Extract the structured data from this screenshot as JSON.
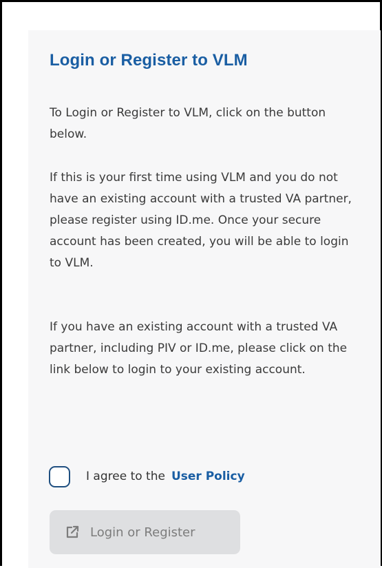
{
  "panel": {
    "title": "Login or Register to VLM",
    "paragraphs": [
      "To Login or Register to VLM, click on the button below.",
      "If this is your first time using VLM and you do not have an existing account with a trusted VA partner, please register using ID.me. Once your secure account has been created, you will be able to login to VLM.",
      "If you have an existing account with a trusted VA partner, including PIV or ID.me, please click on the link below to login to your existing account."
    ],
    "agreement": {
      "checked": false,
      "text": "I agree to the",
      "link_text": "User Policy"
    },
    "login_button": {
      "label": "Login or Register",
      "icon": "external-link-icon",
      "disabled": true
    }
  },
  "colors": {
    "title": "#1a5ea3",
    "link": "#1a5ea3",
    "body_text": "#3a3a3a",
    "card_background": "#f7f7f8",
    "button_disabled_background": "#dedfe1",
    "button_disabled_text": "#7c7c7c",
    "checkbox_border": "#1f4f80"
  }
}
